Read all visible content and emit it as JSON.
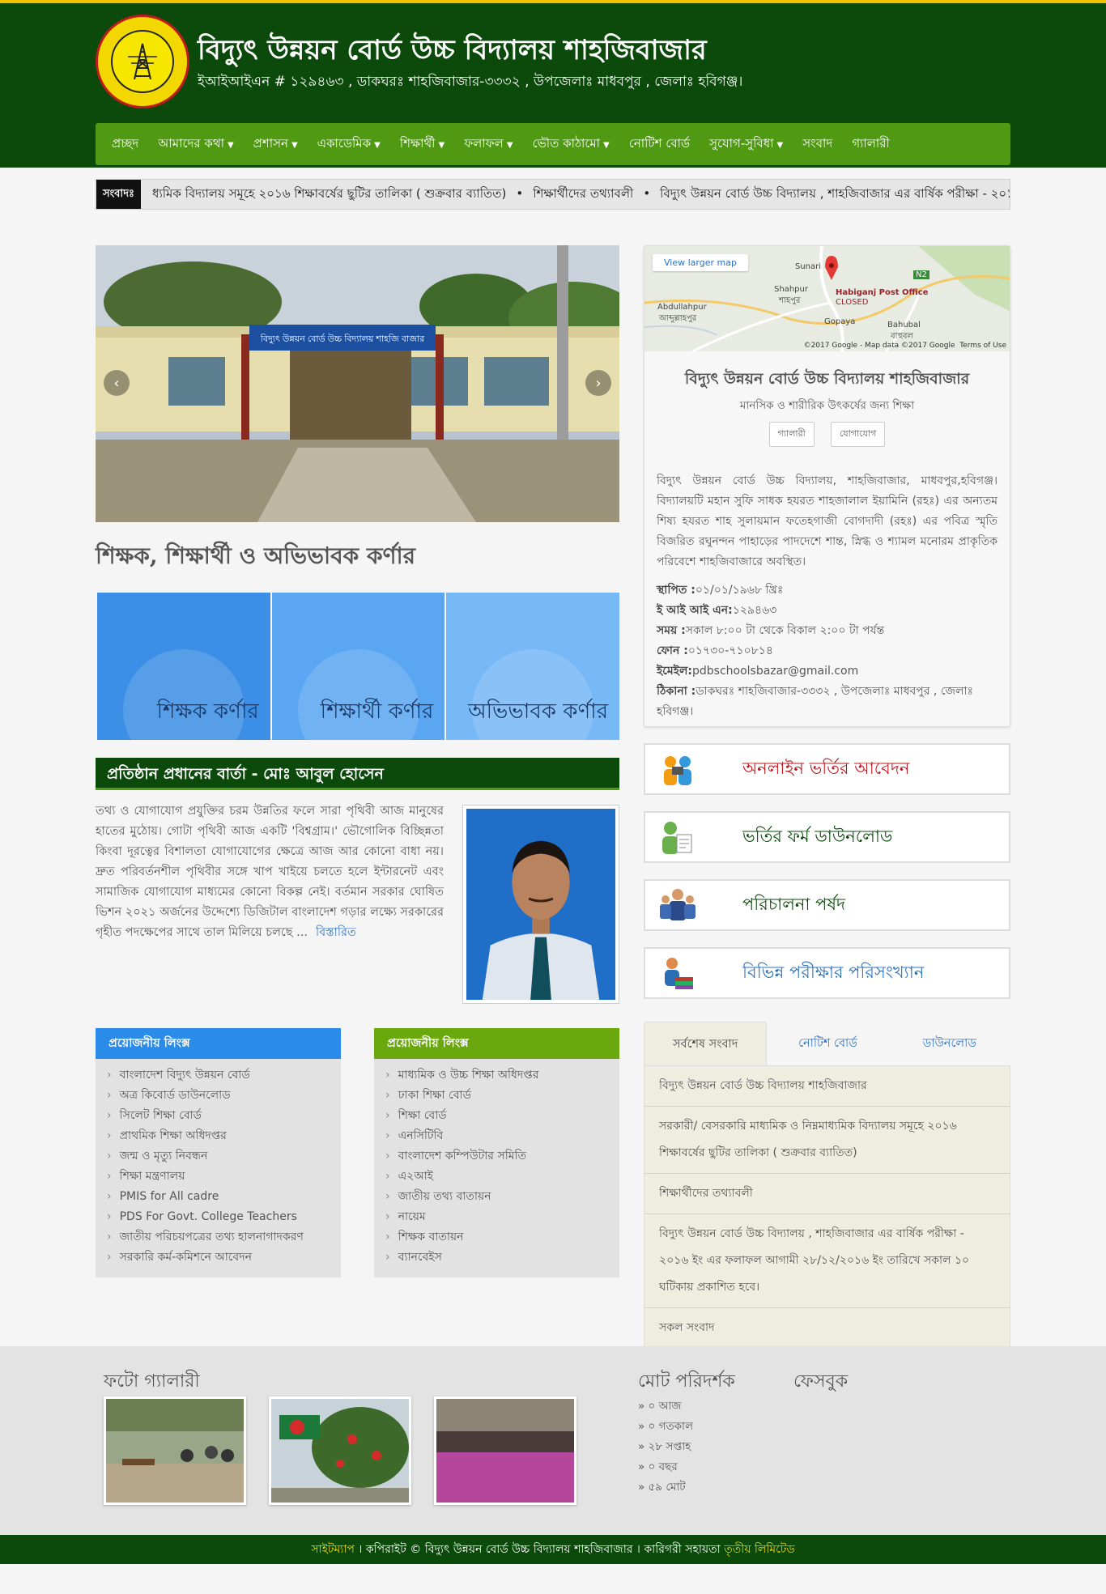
{
  "colors": {
    "header": "#0c4a0c",
    "nav": "#4f9a12",
    "accent_yellow": "#f2c200",
    "link": "#2b72c2",
    "red_link": "#c0181f"
  },
  "header": {
    "logo_text": "বাংলাদেশ বিদ্যুৎ উন্নয়ন বোর্ড",
    "title": "বিদ্যুৎ উন্নয়ন বোর্ড উচ্চ বিদ্যালয় শাহজিবাজার",
    "subtitle": "ইআইআইএন # ১২৯৪৬৩ , ডাকঘরঃ শাহজিবাজার-৩৩৩২ , উপজেলাঃ মাধবপুর , জেলাঃ হবিগঞ্জ।"
  },
  "nav": [
    {
      "label": "প্রচ্ছদ",
      "dropdown": false
    },
    {
      "label": "আমাদের কথা",
      "dropdown": true
    },
    {
      "label": "প্রশাসন",
      "dropdown": true
    },
    {
      "label": "একাডেমিক",
      "dropdown": true
    },
    {
      "label": "শিক্ষার্থী",
      "dropdown": true
    },
    {
      "label": "ফলাফল",
      "dropdown": true
    },
    {
      "label": "ভৌত কাঠামো",
      "dropdown": true
    },
    {
      "label": "নোটিশ বোর্ড",
      "dropdown": false
    },
    {
      "label": "সুযোগ-সুবিধা",
      "dropdown": true
    },
    {
      "label": "সংবাদ",
      "dropdown": false
    },
    {
      "label": "গ্যালারী",
      "dropdown": false
    }
  ],
  "ticker": {
    "label": "সংবাদঃ",
    "items": [
      "ধ্যমিক বিদ্যালয় সমূহে ২০১৬ শিক্ষাবর্ষের ছুটির তালিকা ( শুক্রবার ব্যাতিত)",
      "শিক্ষার্থীদের তথ্যাবলী",
      "বিদ্যুৎ উন্নয়ন বোর্ড উচ্চ বিদ্যালয় , শাহজিবাজার এর বার্ষিক পরীক্ষা - ২০১"
    ]
  },
  "slider": {
    "banner_text": "বিদ্যুৎ উন্নয়ন বোর্ড উচ্চ বিদ্যালয় শাহজি বাজার",
    "prev": "‹",
    "next": "›"
  },
  "corner_section": {
    "heading": "শিক্ষক, শিক্ষার্থী ও অভিভাবক কর্ণার",
    "items": [
      {
        "label": "শিক্ষক কর্ণার",
        "color": "#3c8ee6"
      },
      {
        "label": "শিক্ষার্থী কর্ণার",
        "color": "#5aa6f2"
      },
      {
        "label": "অভিভাবক কর্ণার",
        "color": "#77b8f6"
      }
    ]
  },
  "head_message": {
    "title": "প্রতিষ্ঠান প্রধানের বার্তা - মোঃ আবুল হোসেন",
    "text": "তথ্য ও যোগাযোগ প্রযুক্তির চরম উন্নতির ফলে সারা পৃথিবী আজ মানুষের হাতের মুঠোয়। গোটা পৃথিবী আজ একটি 'বিশ্বগ্রাম।' ভৌগোলিক বিচ্ছিন্নতা কিংবা দূরত্বের বিশালতা যোগাযোগের ক্ষেত্রে আজ আর কোনো বাধা নয়। দ্রুত পরিবর্তনশীল পৃথিবীর সঙ্গে খাপ খাইয়ে চলতে হলে ইন্টারনেট এবং সামাজিক যোগাযোগ মাধ্যমের কোনো বিকল্প নেই। বর্তমান সরকার ঘোষিত ভিশন ২০২১ অর্জনের উদ্দেশ্যে ডিজিটাল বাংলাদেশ গড়ার লক্ষ্যে সরকারের গৃহীত পদক্ষেপের সাথে তাল মিলিয়ে চলছে ...",
    "more": "বিস্তারিত"
  },
  "links_left": {
    "title": "প্রয়োজনীয় লিংক্স",
    "color": "#2b8be8",
    "items": [
      "বাংলাদেশ বিদ্যুৎ উন্নয়ন বোর্ড",
      "অত্র কিবোর্ড ডাউনলোড",
      "সিলেট শিক্ষা বোর্ড",
      "প্রাথমিক শিক্ষা অধিদপ্তর",
      "জন্ম ও মৃত্যু নিবন্ধন",
      "শিক্ষা মন্ত্রণালয়",
      "PMIS for All cadre",
      "PDS For Govt. College Teachers",
      "জাতীয় পরিচয়পত্রের তথ্য হালনাগাদকরণ",
      "সরকারি কর্ম-কমিশনে আবেদন"
    ]
  },
  "links_right": {
    "title": "প্রয়োজনীয় লিংক্স",
    "color": "#6aa80e",
    "items": [
      "মাধ্যমিক ও উচ্চ শিক্ষা অধিদপ্তর",
      "ঢাকা শিক্ষা বোর্ড",
      "শিক্ষা বোর্ড",
      "এনসিটিবি",
      "বাংলাদেশ কম্পিউটার সমিতি",
      "এ২আই",
      "জাতীয় তথ্য বাতায়ন",
      "নায়েম",
      "শিক্ষক বাতায়ন",
      "ব্যানবেইস"
    ]
  },
  "map": {
    "view_larger": "View larger map",
    "post_office": "Habiganj Post Office",
    "closed": "CLOSED",
    "places": [
      "Sunari",
      "Shahpur",
      "শাহপুর",
      "Abdullahpur",
      "আব্দুল্লাহপুর",
      "Gopaya",
      "Bahubal",
      "বাহুবল",
      "N2"
    ],
    "credit": "©2017 Google - Map data ©2017 Google",
    "terms": "Terms of Use"
  },
  "school_card": {
    "title": "বিদ্যুৎ উন্নয়ন বোর্ড উচ্চ বিদ্যালয় শাহজিবাজার",
    "tagline": "মানসিক ও শারীরিক উৎকর্ষের জন্য শিক্ষা",
    "btn_gallery": "গ্যালারী",
    "btn_contact": "যোগাযোগ",
    "about": "বিদ্যুৎ উন্নয়ন বোর্ড উচ্চ বিদ্যালয়, শাহজিবাজার, মাধবপুর,হবিগঞ্জ। বিদ্যালয়টি মহান সুফি সাধক হযরত শাহজালাল ইয়ামিনি (রহঃ) এর অন্যতম শিষ্য হযরত শাহ সুলায়মান ফতেহগাজী বোগদাদী (রহঃ) এর পবিত্র স্মৃতি বিজরিত রঘুনন্দন পাহাড়ের পাদদেশে শান্ত, স্নিগ্ধ ও শ্যামল মনোরম প্রাকৃতিক পরিবেশে শাহজিবাজারে অবস্থিত।",
    "facts": [
      {
        "label": "স্থাপিত :",
        "value": "০১/০১/১৯৬৮ খ্রিঃ"
      },
      {
        "label": "ই আই আই এন:",
        "value": "১২৯৪৬৩"
      },
      {
        "label": "সময় :",
        "value": "সকাল ৮:০০ টা থেকে বিকাল ২:০০ টা পর্যন্ত"
      },
      {
        "label": "ফোন :",
        "value": "০১৭৩০-৭১০৮১৪"
      },
      {
        "label": "ইমেইল:",
        "value": "pdbschoolsbazar@gmail.com"
      },
      {
        "label": "ঠিকানা :",
        "value": "ডাকঘরঃ শাহজিবাজার-৩৩৩২ , উপজেলাঃ মাধবপুর , জেলাঃ হবিগঞ্জ।"
      }
    ]
  },
  "actions": [
    {
      "label": "অনলাইন ভর্তির আবেদন",
      "color": "#c0181f",
      "icon": "team-icon"
    },
    {
      "label": "ভর্তির ফর্ম ডাউনলোড",
      "color": "#0c4a0c",
      "icon": "form-user-icon"
    },
    {
      "label": "পরিচালনা পর্ষদ",
      "color": "#0c4a0c",
      "icon": "committee-icon"
    },
    {
      "label": "বিভিন্ন পরীক্ষার পরিসংখ্যান",
      "color": "#2b72c2",
      "icon": "books-user-icon"
    }
  ],
  "news_tabs": {
    "tabs": [
      "সর্বশেষ সংবাদ",
      "নোটিশ বোর্ড",
      "ডাউনলোড"
    ],
    "items": [
      "বিদ্যুৎ উন্নয়ন বোর্ড উচ্চ বিদ্যালয় শাহজিবাজার",
      "সরকারী/ বেসরকারি মাধ্যমিক ও নিম্নমাধ্যমিক বিদ্যালয় সমূহে ২০১৬ শিক্ষাবর্ষের ছুটির তালিকা ( শুক্রবার ব্যাতিত)",
      "শিক্ষার্থীদের তথ্যাবলী",
      "বিদ্যুৎ উন্নয়ন বোর্ড উচ্চ বিদ্যালয় , শাহজিবাজার এর বার্ষিক পরীক্ষা - ২০১৬ ইং এর ফলাফল আগামী ২৮/১২/২০১৬ ইং তারিখে সকাল ১০ ঘটিকায় প্রকাশিত হবে।",
      "সকল সংবাদ"
    ]
  },
  "footer": {
    "gallery_title": "ফটো গ্যালারী",
    "visitors_title": "মোট পরিদর্শক",
    "facebook_title": "ফেসবুক",
    "visitors": [
      "» ০ আজ",
      "» ০ গতকাল",
      "» ২৮ সপ্তাহ",
      "» ০ বছর",
      "» ৫৯ মোট"
    ],
    "sitemap": "সাইটম্যাপ",
    "copyright": " । কপিরাইট © বিদ্যুৎ উন্নয়ন বোর্ড উচ্চ বিদ্যালয় শাহজিবাজার । কারিগরী সহায়তা ",
    "developer": "তৃতীয় লিমিটেড"
  }
}
